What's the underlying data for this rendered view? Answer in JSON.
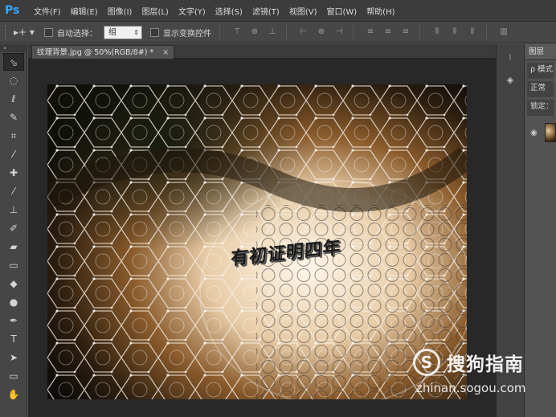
{
  "app": {
    "logo": "Ps"
  },
  "menu": [
    "文件(F)",
    "编辑(E)",
    "图像(I)",
    "图层(L)",
    "文字(Y)",
    "选择(S)",
    "滤镜(T)",
    "视图(V)",
    "窗口(W)",
    "帮助(H)"
  ],
  "options": {
    "move_glyph": "▸+ ▾",
    "auto_select_label": "自动选择：",
    "auto_select_value": "组",
    "transform_label": "显示变换控件"
  },
  "document": {
    "tab_title": "纹理背景.jpg @ 50%(RGB/8#) *",
    "tab_close": "×",
    "canvas_text": "有初证明四年"
  },
  "toolbox": {
    "header": "» ",
    "tools": [
      {
        "name": "move-tool",
        "glyph": "⬂",
        "icon": "move-icon"
      },
      {
        "name": "marquee-tool",
        "glyph": "◌",
        "icon": "ellipse-marquee-icon"
      },
      {
        "name": "lasso-tool",
        "glyph": "ℓ",
        "icon": "lasso-icon"
      },
      {
        "name": "quick-select-tool",
        "glyph": "✎",
        "icon": "quick-select-icon"
      },
      {
        "name": "crop-tool",
        "glyph": "⌗",
        "icon": "crop-icon"
      },
      {
        "name": "eyedropper-tool",
        "glyph": "⁄",
        "icon": "eyedropper-icon"
      },
      {
        "name": "healing-tool",
        "glyph": "✚",
        "icon": "healing-brush-icon"
      },
      {
        "name": "brush-tool",
        "glyph": "⁄",
        "icon": "brush-icon"
      },
      {
        "name": "stamp-tool",
        "glyph": "⊥",
        "icon": "clone-stamp-icon"
      },
      {
        "name": "history-brush-tool",
        "glyph": "✐",
        "icon": "history-brush-icon"
      },
      {
        "name": "eraser-tool",
        "glyph": "▰",
        "icon": "eraser-icon"
      },
      {
        "name": "gradient-tool",
        "glyph": "▭",
        "icon": "gradient-icon"
      },
      {
        "name": "blur-tool",
        "glyph": "◆",
        "icon": "blur-icon"
      },
      {
        "name": "dodge-tool",
        "glyph": "●",
        "icon": "dodge-icon"
      },
      {
        "name": "pen-tool",
        "glyph": "✒",
        "icon": "pen-icon"
      },
      {
        "name": "type-tool",
        "glyph": "T",
        "icon": "type-icon"
      },
      {
        "name": "path-select-tool",
        "glyph": "➤",
        "icon": "path-selection-icon"
      },
      {
        "name": "shape-tool",
        "glyph": "▭",
        "icon": "rectangle-shape-icon"
      },
      {
        "name": "hand-tool",
        "glyph": "✋",
        "icon": "hand-icon"
      }
    ]
  },
  "layers_panel": {
    "tab": "图层",
    "search_placeholder": "ρ 模式",
    "blend_mode": "正常",
    "lock_label": "锁定：",
    "eye": "◉"
  },
  "right_strip": {
    "btn1": "⁝",
    "btn2": "◈"
  },
  "watermark": {
    "logo": "S",
    "name": "搜狗指南",
    "url": "zhinan.sogou.com"
  },
  "colors": {
    "menu_bg": "#3c3c3c",
    "panel_bg": "#535353",
    "ps_blue": "#31a8ff"
  }
}
